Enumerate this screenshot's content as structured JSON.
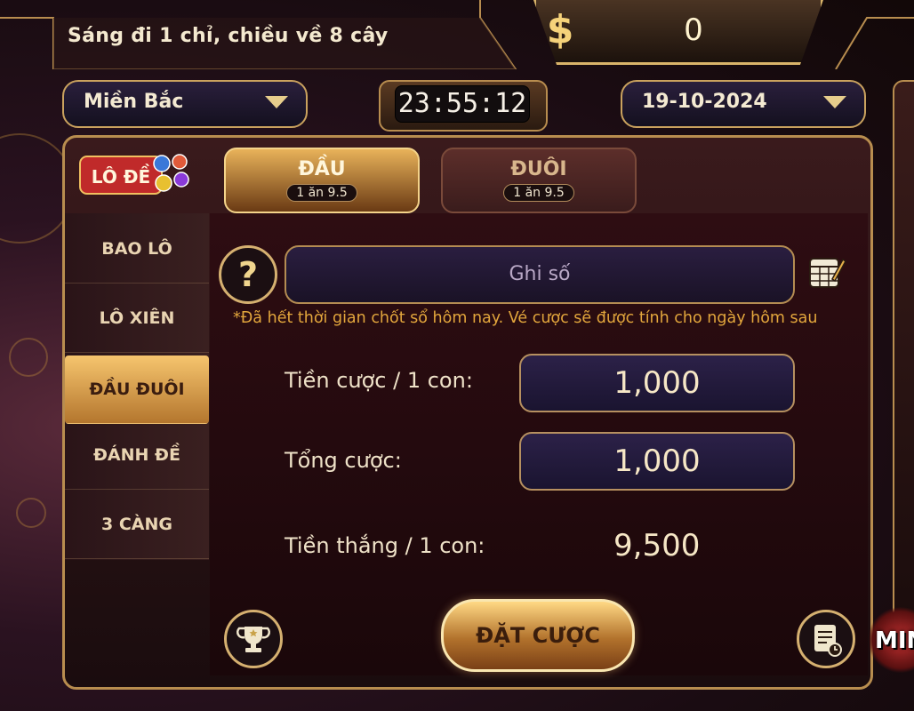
{
  "header": {
    "slogan": "Sáng đi 1 chỉ, chiều về 8 cây",
    "balance": "0",
    "coin_icon": "$"
  },
  "filters": {
    "region": "Miền Bắc",
    "countdown": "23:55:12",
    "date": "19-10-2024"
  },
  "logo": {
    "text": "LÔ ĐỀ"
  },
  "sidebar": {
    "items": [
      {
        "label": "BAO LÔ",
        "active": false
      },
      {
        "label": "LÔ XIÊN",
        "active": false
      },
      {
        "label": "ĐẦU ĐUÔI",
        "active": true
      },
      {
        "label": "ĐÁNH ĐỀ",
        "active": false
      },
      {
        "label": "3 CÀNG",
        "active": false
      }
    ]
  },
  "tabs": [
    {
      "title": "ĐẦU",
      "sub": "1 ăn 9.5",
      "active": true
    },
    {
      "title": "ĐUÔI",
      "sub": "1 ăn 9.5",
      "active": false
    }
  ],
  "form": {
    "help_symbol": "?",
    "number_placeholder": "Ghi số",
    "notice": "*Đã hết thời gian chốt sổ hôm nay. Vé cược sẽ được tính cho ngày hôm sau",
    "bet_per_label": "Tiền cược / 1 con:",
    "bet_per_value": "1,000",
    "total_label": "Tổng cược:",
    "total_value": "1,000",
    "win_label": "Tiền thắng / 1 con:",
    "win_value": "9,500",
    "submit_label": "ĐẶT CƯỢC"
  },
  "mini": {
    "label": "MIN"
  },
  "icons": [
    "dollar-coin-icon",
    "dropdown-arrow-icon",
    "question-icon",
    "edit-table-icon",
    "trophy-icon",
    "history-icon"
  ],
  "colors": {
    "gold": "#d9b46a",
    "accent_orange": "#e2a63c",
    "panel_dark": "#1a070a"
  }
}
